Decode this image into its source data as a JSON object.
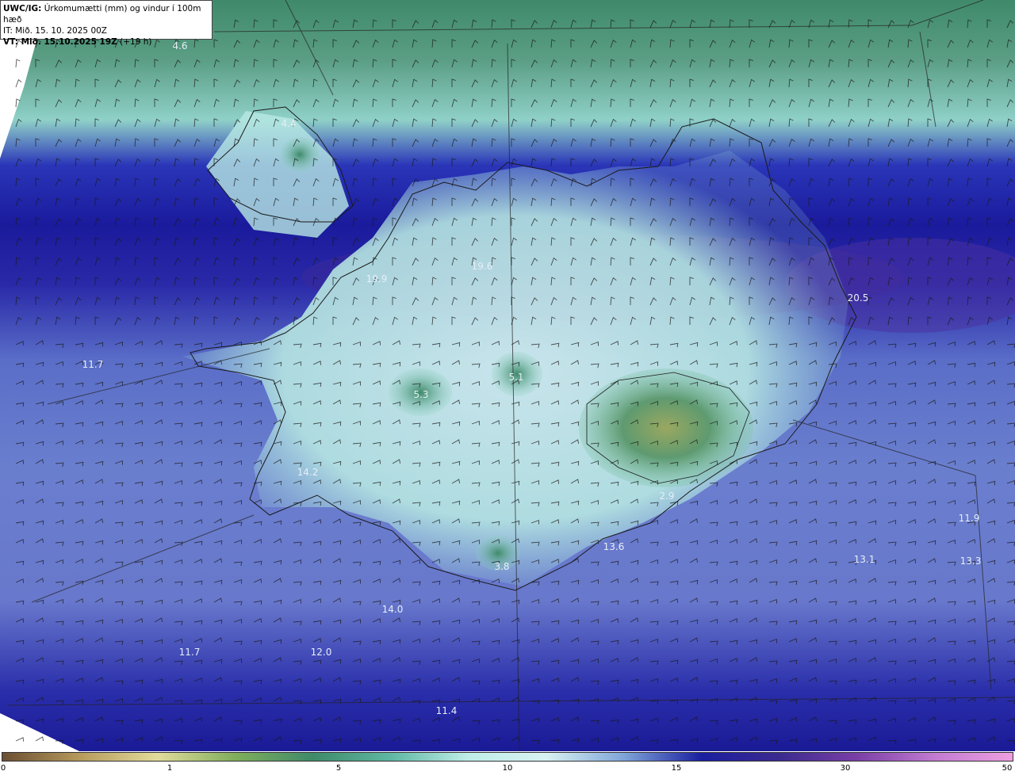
{
  "header": {
    "title_prefix": "UWC/IG:",
    "title_text": "Úrkomumætti (mm) og vindur í 100m hæð",
    "it_line": "IT: Mið. 15. 10. 2025 00Z",
    "vt_prefix": "VT: Mið. 15.10.2025 19Z",
    "vt_suffix": "(+19 h)"
  },
  "colorbar": {
    "ticks": [
      "0",
      "1",
      "5",
      "10",
      "15",
      "30",
      "50"
    ],
    "colors": [
      "#6b4f33",
      "#b69a5c",
      "#e2dc9c",
      "#7fae5c",
      "#3f8a6a",
      "#5fb7a3",
      "#bfeee8",
      "#d8f2f2",
      "#7fa4d8",
      "#1a1fa0",
      "#3b2a8f",
      "#7a3fa6",
      "#c27bd1",
      "#ee9fe0"
    ]
  },
  "values": [
    {
      "id": "v1",
      "text": "4.6"
    },
    {
      "id": "v2",
      "text": "4.4"
    },
    {
      "id": "v3",
      "text": "19.9"
    },
    {
      "id": "v4",
      "text": "19.6"
    },
    {
      "id": "v5",
      "text": "20.5"
    },
    {
      "id": "v6",
      "text": "11.7"
    },
    {
      "id": "v7",
      "text": "5.3"
    },
    {
      "id": "v8",
      "text": "5.1"
    },
    {
      "id": "v9",
      "text": "14.2"
    },
    {
      "id": "v10",
      "text": "2.9"
    },
    {
      "id": "v11",
      "text": "11.9"
    },
    {
      "id": "v12",
      "text": "13.6"
    },
    {
      "id": "v13",
      "text": "13.1"
    },
    {
      "id": "v14",
      "text": "13.3"
    },
    {
      "id": "v15",
      "text": "3.8"
    },
    {
      "id": "v16",
      "text": "14.0"
    },
    {
      "id": "v17",
      "text": "11.7"
    },
    {
      "id": "v18",
      "text": "12.0"
    },
    {
      "id": "v19",
      "text": "11.4"
    }
  ]
}
